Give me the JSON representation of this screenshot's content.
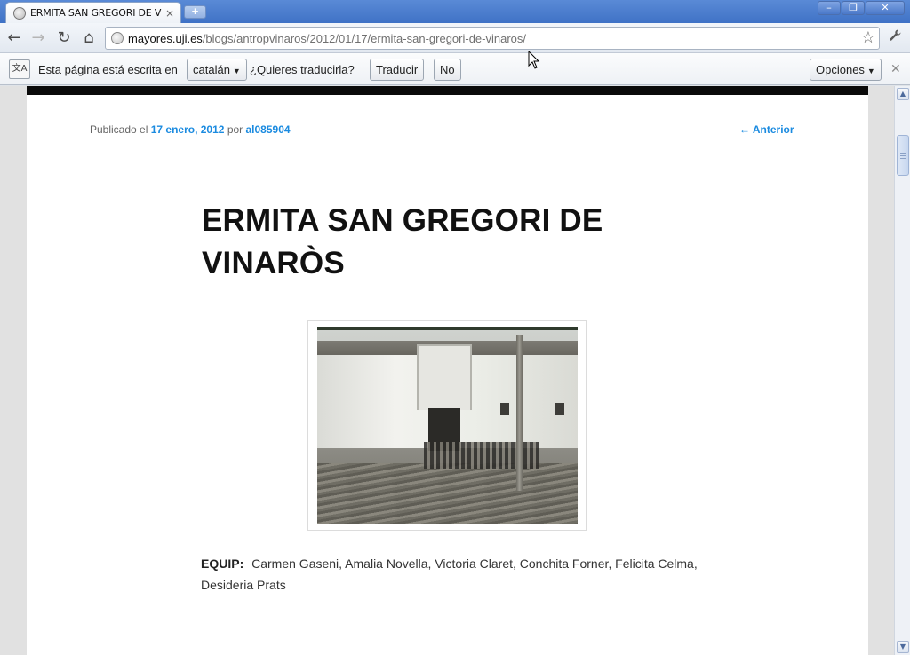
{
  "browser": {
    "tab": {
      "title": "ERMITA SAN GREGORI DE VIN",
      "close": "×"
    },
    "new_tab": "+",
    "window_controls": {
      "minimize": "–",
      "restore": "❐",
      "close": "✕"
    },
    "nav": {
      "back": "←",
      "forward": "→",
      "reload": "↻",
      "home": "⌂",
      "star": "☆",
      "wrench": "🔧"
    },
    "url": {
      "host": "mayores.uji.es",
      "path": "/blogs/antropvinaros/2012/01/17/ermita-san-gregori-de-vinaros/"
    }
  },
  "translate_bar": {
    "icon": "文A",
    "prefix": "Esta página está escrita en",
    "language": "catalán",
    "question": "¿Quieres traducirla?",
    "translate_button": "Traducir",
    "no_button": "No",
    "options_button": "Opciones",
    "close": "✕"
  },
  "post": {
    "meta_prefix": "Publicado el",
    "date": "17 enero, 2012",
    "meta_by": "por",
    "author": "al085904",
    "prev_link": "← Anterior",
    "title": "ERMITA SAN GREGORI DE VINARÒS",
    "team_label": "EQUIP:",
    "team_members": "Carmen Gaseni, Amalia Novella, Victoria Claret, Conchita Forner, Felicita Celma, Desideria Prats"
  },
  "scrollbar": {
    "up": "▲",
    "down": "▼"
  },
  "colors": {
    "link": "#1b8be0",
    "title_bar": "#4a7bd0",
    "page_top_bar": "#0a0a0a"
  }
}
